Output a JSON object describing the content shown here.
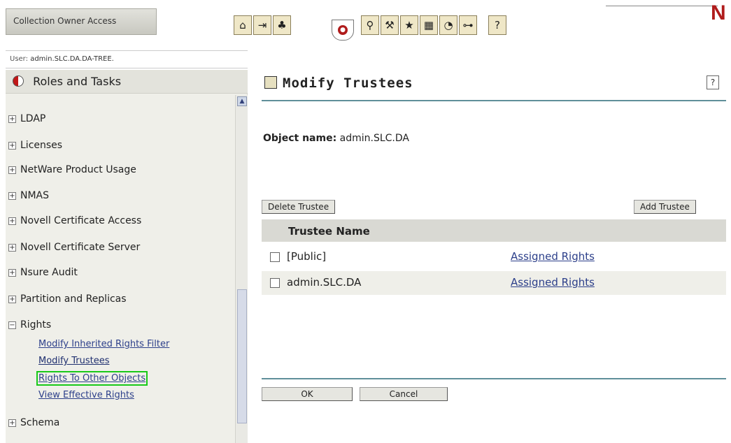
{
  "header": {
    "panel_label": "Collection Owner Access",
    "brand_letter": "N",
    "toolbar_icons": [
      "home-icon",
      "exit-icon",
      "tree-icon",
      "search-icon",
      "tools-icon",
      "favorites-icon",
      "objects-icon",
      "status-icon",
      "network-icon",
      "help-book-icon"
    ]
  },
  "user": {
    "label": "User:",
    "value": "admin.SLC.DA.DA-TREE."
  },
  "sidebar": {
    "title": "Roles and Tasks",
    "items": [
      {
        "label": "LDAP",
        "expander": "+"
      },
      {
        "label": "Licenses",
        "expander": "+"
      },
      {
        "label": "NetWare Product Usage",
        "expander": "+"
      },
      {
        "label": "NMAS",
        "expander": "+"
      },
      {
        "label": "Novell Certificate Access",
        "expander": "+"
      },
      {
        "label": "Novell Certificate Server",
        "expander": "+"
      },
      {
        "label": "Nsure Audit",
        "expander": "+"
      },
      {
        "label": "Partition and Replicas",
        "expander": "+"
      },
      {
        "label": "Rights",
        "expander": "−"
      },
      {
        "label": "Schema",
        "expander": "+"
      }
    ],
    "rights_tasks": [
      "Modify Inherited Rights Filter",
      "Modify Trustees",
      "Rights To Other Objects",
      "View Effective Rights"
    ]
  },
  "main": {
    "title": "Modify Trustees",
    "help_label": "?",
    "object_label": "Object name:",
    "object_value": "admin.SLC.DA",
    "delete_button": "Delete Trustee",
    "add_button": "Add Trustee",
    "table": {
      "header": "Trustee Name",
      "rows": [
        {
          "name": "[Public]",
          "link": "Assigned Rights"
        },
        {
          "name": "admin.SLC.DA",
          "link": "Assigned Rights"
        }
      ]
    },
    "ok_button": "OK",
    "cancel_button": "Cancel"
  },
  "colors": {
    "accent_rule": "#5f8f9a",
    "link": "#2c3f8a",
    "highlight": "#19c919",
    "brand": "#b01c1c"
  }
}
